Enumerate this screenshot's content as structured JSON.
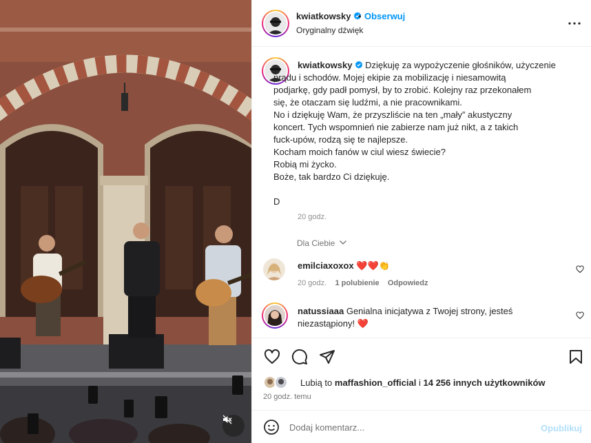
{
  "header": {
    "username": "kwiatkowsky",
    "verified": true,
    "separator": "•",
    "follow_label": "Obserwuj",
    "audio": "Oryginalny dźwięk",
    "more_icon": "more-horizontal-icon"
  },
  "caption": {
    "username": "kwiatkowsky",
    "lines": [
      "Dziękuję za wypożyczenie głośników, użyczenie",
      "prądu i schodów. Mojej ekipie za mobilizację i niesamowitą",
      "podjarkę, gdy padł pomysł, by to zrobić. Kolejny raz przekonałem",
      "się, że otaczam się ludźmi, a nie pracownikami.",
      "No i dziękuję Wam, że przyszliście na ten „mały” akustyczny",
      "koncert. Tych wspomnień nie zabierze nam już nikt, a z takich",
      "fuck-upów, rodzą się te najlepsze.",
      "Kocham moich fanów w ciul wiesz świecie?",
      "Robią mi życko.",
      "Boże, tak bardzo Ci dziękuję.",
      "",
      "D"
    ],
    "time": "20 godz."
  },
  "for_you": "Dla Ciebie",
  "comments": [
    {
      "username": "emilciaxoxox",
      "text": "❤️❤️👏",
      "time": "20 godz.",
      "likes": "1 polubienie",
      "reply": "Odpowiedz"
    },
    {
      "username": "natussiaaa",
      "text_line1": "Genialna inicjatywa z Twojej strony, jesteś",
      "text_line2": "niezastąpiony! ❤️"
    }
  ],
  "actions": {
    "like_icon": "heart-icon",
    "comment_icon": "comment-icon",
    "share_icon": "send-icon",
    "save_icon": "bookmark-icon"
  },
  "likes": {
    "prefix": "Lubią to",
    "user": "maffashion_official",
    "joiner": "i",
    "count_text": "14 256 innych użytkowników"
  },
  "posted": "20 godz. temu",
  "add_comment": {
    "placeholder": "Dodaj komentarz...",
    "publish": "Opublikuj"
  },
  "colors": {
    "accent": "#0095f6",
    "publish_disabled": "#b2dffc",
    "heart": "#ed4956"
  }
}
